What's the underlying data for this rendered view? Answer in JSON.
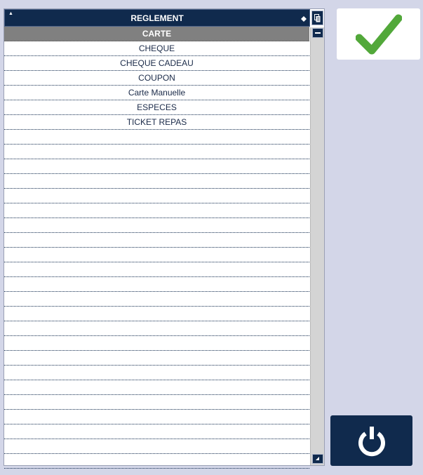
{
  "table": {
    "header": "REGLEMENT",
    "rows": [
      {
        "label": "CARTE",
        "selected": true
      },
      {
        "label": "CHEQUE"
      },
      {
        "label": "CHEQUE CADEAU"
      },
      {
        "label": "COUPON"
      },
      {
        "label": "Carte Manuelle"
      },
      {
        "label": "ESPECES"
      },
      {
        "label": "TICKET REPAS"
      },
      {
        "label": ""
      },
      {
        "label": ""
      },
      {
        "label": ""
      },
      {
        "label": ""
      },
      {
        "label": ""
      },
      {
        "label": ""
      },
      {
        "label": ""
      },
      {
        "label": ""
      },
      {
        "label": ""
      },
      {
        "label": ""
      },
      {
        "label": ""
      },
      {
        "label": ""
      },
      {
        "label": ""
      },
      {
        "label": ""
      },
      {
        "label": ""
      },
      {
        "label": ""
      },
      {
        "label": ""
      },
      {
        "label": ""
      },
      {
        "label": ""
      },
      {
        "label": ""
      },
      {
        "label": ""
      },
      {
        "label": ""
      },
      {
        "label": ""
      }
    ]
  },
  "icons": {
    "sort": "sort-arrow-icon",
    "filter": "filter-icon",
    "header_tool": "copy-icon",
    "scroll_up": "minus-icon",
    "scroll_down": "scroll-down-icon",
    "confirm": "checkmark-icon",
    "power": "power-icon"
  },
  "colors": {
    "navy": "#102a4d",
    "background": "#d3d6e8",
    "selected_row": "#808080",
    "check_green": "#52a83a"
  }
}
